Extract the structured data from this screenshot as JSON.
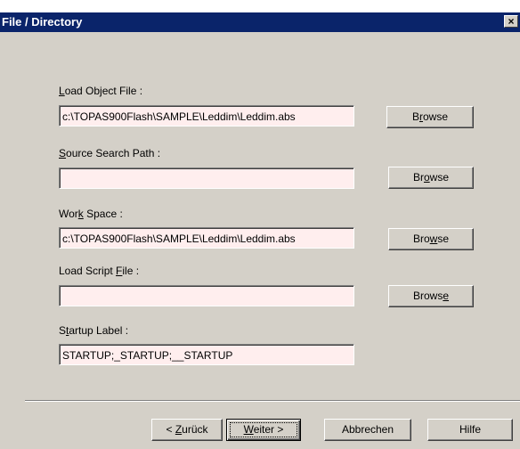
{
  "window": {
    "title": "File / Directory",
    "close_glyph": "×"
  },
  "fields": [
    {
      "label_pre": "",
      "label_key": "L",
      "label_post": "oad Object File :",
      "value": "c:\\TOPAS900Flash\\SAMPLE\\Leddim\\Leddim.abs",
      "browse_pre": "B",
      "browse_key": "r",
      "browse_post": "owse"
    },
    {
      "label_pre": "",
      "label_key": "S",
      "label_post": "ource Search Path :",
      "value": "",
      "browse_pre": "Br",
      "browse_key": "o",
      "browse_post": "wse"
    },
    {
      "label_pre": "Wor",
      "label_key": "k",
      "label_post": " Space :",
      "value": "c:\\TOPAS900Flash\\SAMPLE\\Leddim\\Leddim.abs",
      "browse_pre": "Bro",
      "browse_key": "w",
      "browse_post": "se"
    },
    {
      "label_pre": "Load Script ",
      "label_key": "F",
      "label_post": "ile :",
      "value": "",
      "browse_pre": "Brows",
      "browse_key": "e",
      "browse_post": ""
    },
    {
      "label_pre": "S",
      "label_key": "t",
      "label_post": "artup Label :",
      "value": "STARTUP;_STARTUP;__STARTUP"
    }
  ],
  "buttons": {
    "back_pre": "< ",
    "back_key": "Z",
    "back_post": "urück",
    "next_pre": "",
    "next_key": "W",
    "next_post": "eiter >",
    "cancel": "Abbrechen",
    "help": "Hilfe"
  }
}
